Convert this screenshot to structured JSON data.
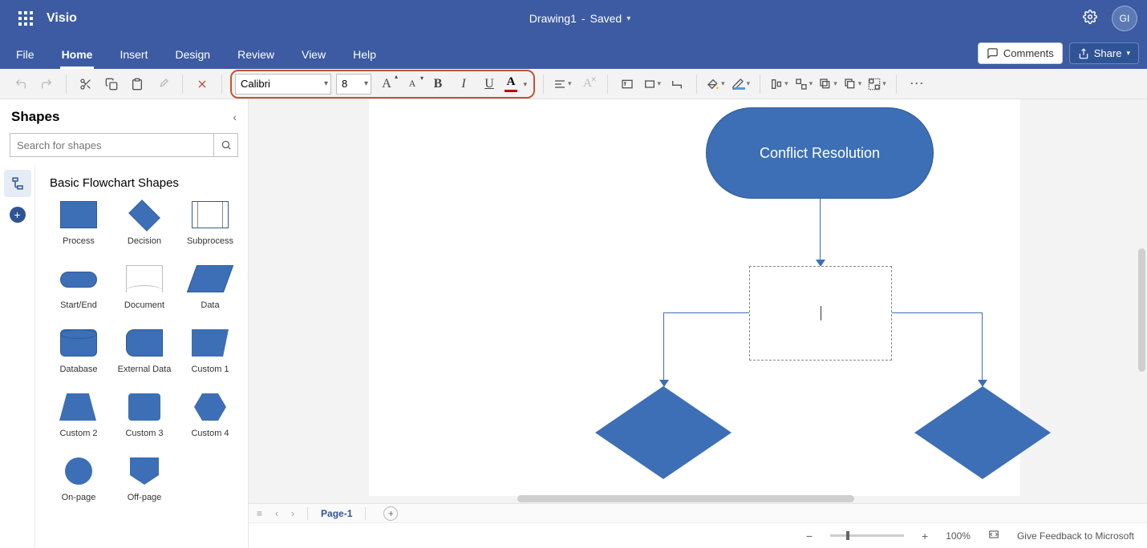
{
  "titlebar": {
    "app_name": "Visio",
    "doc_name": "Drawing1",
    "doc_separator": "-",
    "doc_status": "Saved",
    "avatar_initials": "GI"
  },
  "menu": {
    "items": [
      "File",
      "Home",
      "Insert",
      "Design",
      "Review",
      "View",
      "Help"
    ],
    "active_index": 1,
    "comments_label": "Comments",
    "share_label": "Share"
  },
  "ribbon": {
    "font_name": "Calibri",
    "font_size": "8"
  },
  "shapes_panel": {
    "title": "Shapes",
    "search_placeholder": "Search for shapes",
    "category": "Basic Flowchart Shapes",
    "shapes": [
      {
        "label": "Process",
        "icon": "process"
      },
      {
        "label": "Decision",
        "icon": "decision"
      },
      {
        "label": "Subprocess",
        "icon": "subprocess"
      },
      {
        "label": "Start/End",
        "icon": "startend"
      },
      {
        "label": "Document",
        "icon": "document"
      },
      {
        "label": "Data",
        "icon": "data"
      },
      {
        "label": "Database",
        "icon": "database"
      },
      {
        "label": "External Data",
        "icon": "extdata"
      },
      {
        "label": "Custom 1",
        "icon": "custom1"
      },
      {
        "label": "Custom 2",
        "icon": "custom2"
      },
      {
        "label": "Custom 3",
        "icon": "custom3b"
      },
      {
        "label": "Custom 4",
        "icon": "custom4"
      },
      {
        "label": "On-page",
        "icon": "onpage"
      },
      {
        "label": "Off-page",
        "icon": "offpage"
      }
    ]
  },
  "canvas": {
    "start_shape_text": "Conflict Resolution"
  },
  "pagetabs": {
    "page1": "Page-1"
  },
  "statusbar": {
    "zoom_percent": "100%",
    "feedback": "Give Feedback to Microsoft"
  }
}
